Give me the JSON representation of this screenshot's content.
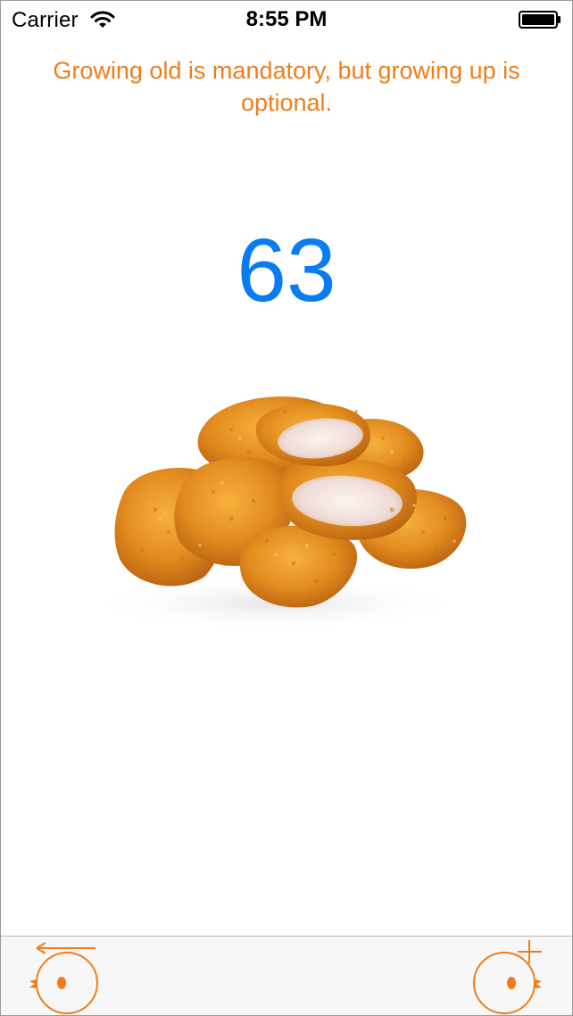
{
  "status_bar": {
    "carrier": "Carrier",
    "time": "8:55 PM",
    "wifi_icon": "wifi-icon",
    "battery_icon": "battery-icon"
  },
  "quote": {
    "text": "Growing old is mandatory, but growing up is optional."
  },
  "counter": {
    "value": "63"
  },
  "image": {
    "subject": "chicken nuggets"
  },
  "toolbar": {
    "left_icon": "chick-back-arrow-icon",
    "right_icon": "chick-plus-icon"
  },
  "colors": {
    "accent_orange": "#f07d1a",
    "counter_blue": "#0a7cf2",
    "toolbar_bg": "#f7f7f7"
  }
}
